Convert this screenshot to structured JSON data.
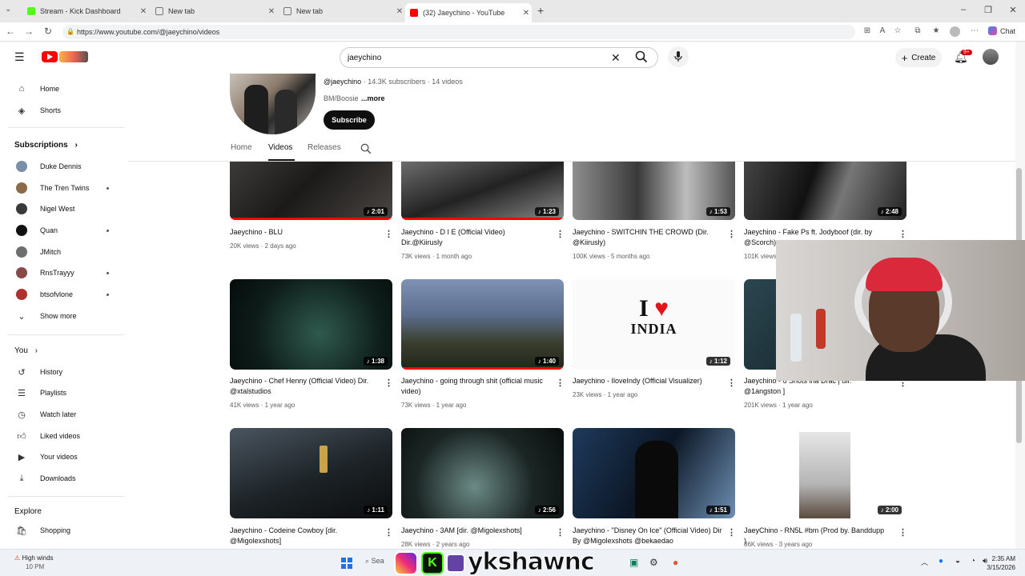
{
  "browser": {
    "tabs": [
      {
        "title": "Stream - Kick Dashboard",
        "icon": "kick-icon",
        "color": "#53fc18"
      },
      {
        "title": "New tab",
        "icon": "page-icon"
      },
      {
        "title": "New tab",
        "icon": "page-icon"
      },
      {
        "title": "(32) Jaeychino - YouTube",
        "icon": "youtube-icon",
        "color": "#ff0000"
      }
    ],
    "url": "https://www.youtube.com/@jaeychino/videos",
    "chat_label": "Chat"
  },
  "youtube": {
    "search_value": "jaeychino",
    "create_label": "Create",
    "notification_count": "9+"
  },
  "sidebar": {
    "main": [
      {
        "label": "Home",
        "icon": "home-icon"
      },
      {
        "label": "Shorts",
        "icon": "shorts-icon"
      }
    ],
    "subscriptions_header": "Subscriptions",
    "subscriptions": [
      {
        "label": "Duke Dennis",
        "live": false
      },
      {
        "label": "The Tren Twins",
        "live": true
      },
      {
        "label": "Nigel West",
        "live": false
      },
      {
        "label": "Quan",
        "live": true
      },
      {
        "label": "JMitch",
        "live": false
      },
      {
        "label": "RnsTrayyy",
        "live": true
      },
      {
        "label": "btsofvlone",
        "live": true
      }
    ],
    "show_more": "Show more",
    "you_header": "You",
    "you_items": [
      {
        "label": "History",
        "icon": "history-icon"
      },
      {
        "label": "Playlists",
        "icon": "playlists-icon"
      },
      {
        "label": "Watch later",
        "icon": "watch-later-icon"
      },
      {
        "label": "Liked videos",
        "icon": "like-icon"
      },
      {
        "label": "Your videos",
        "icon": "your-videos-icon"
      },
      {
        "label": "Downloads",
        "icon": "download-icon"
      }
    ],
    "explore_header": "Explore",
    "explore_items": [
      {
        "label": "Shopping",
        "icon": "shopping-icon"
      }
    ]
  },
  "channel": {
    "handle": "@jaeychino",
    "subscribers": "14.3K subscribers",
    "videos_count": "14 videos",
    "sep": "·",
    "description": "BM/Boosie",
    "more": "...more",
    "subscribe_label": "Subscribe",
    "tabs": [
      "Home",
      "Videos",
      "Releases"
    ]
  },
  "videos": [
    {
      "title": "Jaeychino - BLU",
      "views": "20K views",
      "age": "2 days ago",
      "duration": "2:01",
      "progress": 1.0
    },
    {
      "title": "Jaeychino - D I E (Official Video) Dir.@Kiirusly",
      "views": "73K views",
      "age": "1 month ago",
      "duration": "1:23",
      "progress": 1.0
    },
    {
      "title": "Jaeychino - SWITCHIN THE CROWD (Dir. @Kiirusly)",
      "views": "100K views",
      "age": "5 months ago",
      "duration": "1:53",
      "progress": 0
    },
    {
      "title": "Jaeychino - Fake Ps ft. Jodyboof (dir. by @Scorch)",
      "views": "101K views",
      "age": "",
      "duration": "2:48",
      "progress": 0
    },
    {
      "title": "Jaeychino - Chef Henny (Official Video) Dir. @xtalstudios",
      "views": "41K views",
      "age": "1 year ago",
      "duration": "1:38",
      "progress": 0
    },
    {
      "title": "Jaeychino - going through shit (official music video)",
      "views": "73K views",
      "age": "1 year ago",
      "duration": "1:40",
      "progress": 1.0
    },
    {
      "title": "Jaeychino - IloveIndy (Official Visualizer)",
      "views": "23K views",
      "age": "1 year ago",
      "duration": "1:12",
      "progress": 0
    },
    {
      "title": "Jaeychino - 6 Shots ina Drac | dir. @1angston ]",
      "views": "201K views",
      "age": "1 year ago",
      "duration": "",
      "progress": 0
    },
    {
      "title": "Jaeychino - Codeine Cowboy [dir. @Migolexshots]",
      "views": "",
      "age": "",
      "duration": "1:11",
      "progress": 0
    },
    {
      "title": "Jaeychino - 3AM [dir. @Migolexshots]",
      "views": "28K views",
      "age": "2 years ago",
      "duration": "2:56",
      "progress": 0
    },
    {
      "title": "Jaeychino - \"Disney On Ice\" (Official Video) Dir By @Migolexshots @bekaedao",
      "views": "",
      "age": "",
      "duration": "1:51",
      "progress": 0
    },
    {
      "title": "JaeyChino - RN5L #bm (Prod by. Banddupp )",
      "views": "36K views",
      "age": "3 years ago",
      "duration": "2:00",
      "progress": 0
    }
  ],
  "thumb3_text": {
    "line1": "I",
    "line2": "INDIA"
  },
  "taskbar": {
    "weather_title": "High winds",
    "weather_sub": "10 PM",
    "search_label": "Sea",
    "overlay_text": "ykshawnc",
    "time": "2:35 AM",
    "date": "3/15/2026"
  }
}
